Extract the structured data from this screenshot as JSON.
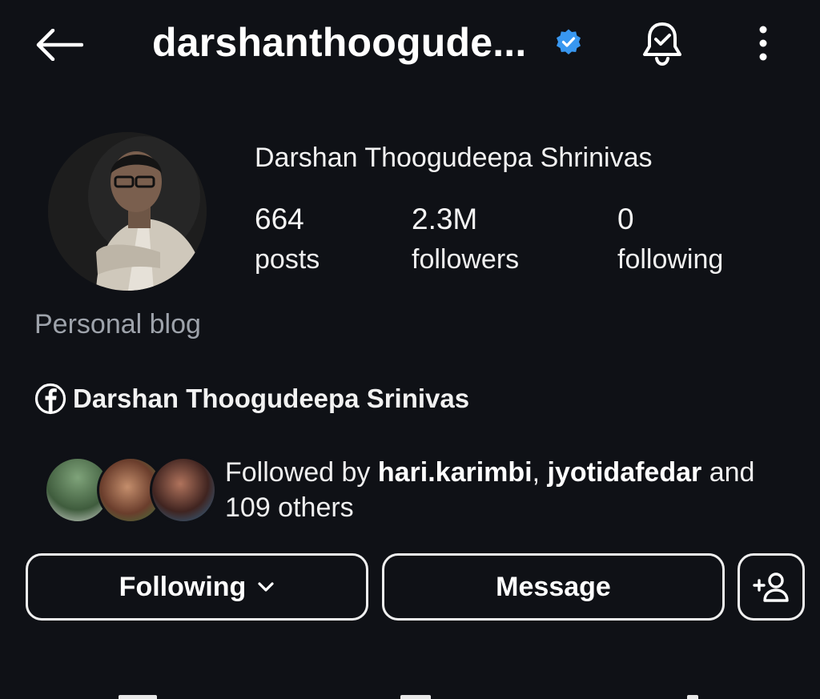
{
  "header": {
    "username": "darshanthoogude...",
    "verified": true
  },
  "profile": {
    "display_name": "Darshan Thoogudeepa Shrinivas",
    "category": "Personal blog",
    "stats": {
      "posts": {
        "value": "664",
        "label": "posts"
      },
      "followers": {
        "value": "2.3M",
        "label": "followers"
      },
      "following": {
        "value": "0",
        "label": "following"
      }
    },
    "facebook_link": "Darshan Thoogudeepa Srinivas"
  },
  "mutual": {
    "prefix": "Followed by ",
    "user1": "hari.karimbi",
    "separator": ", ",
    "user2": "jyotidafedar",
    "suffix_and": " and",
    "others": "109 others"
  },
  "actions": {
    "following_label": "Following",
    "message_label": "Message"
  },
  "colors": {
    "background": "#0f1116",
    "verified_blue": "#3897f0",
    "secondary_text": "#9ea3ab"
  },
  "icons": [
    "back-arrow-icon",
    "verified-badge-icon",
    "bell-check-icon",
    "more-vertical-icon",
    "facebook-icon",
    "chevron-down-icon",
    "add-user-icon"
  ]
}
